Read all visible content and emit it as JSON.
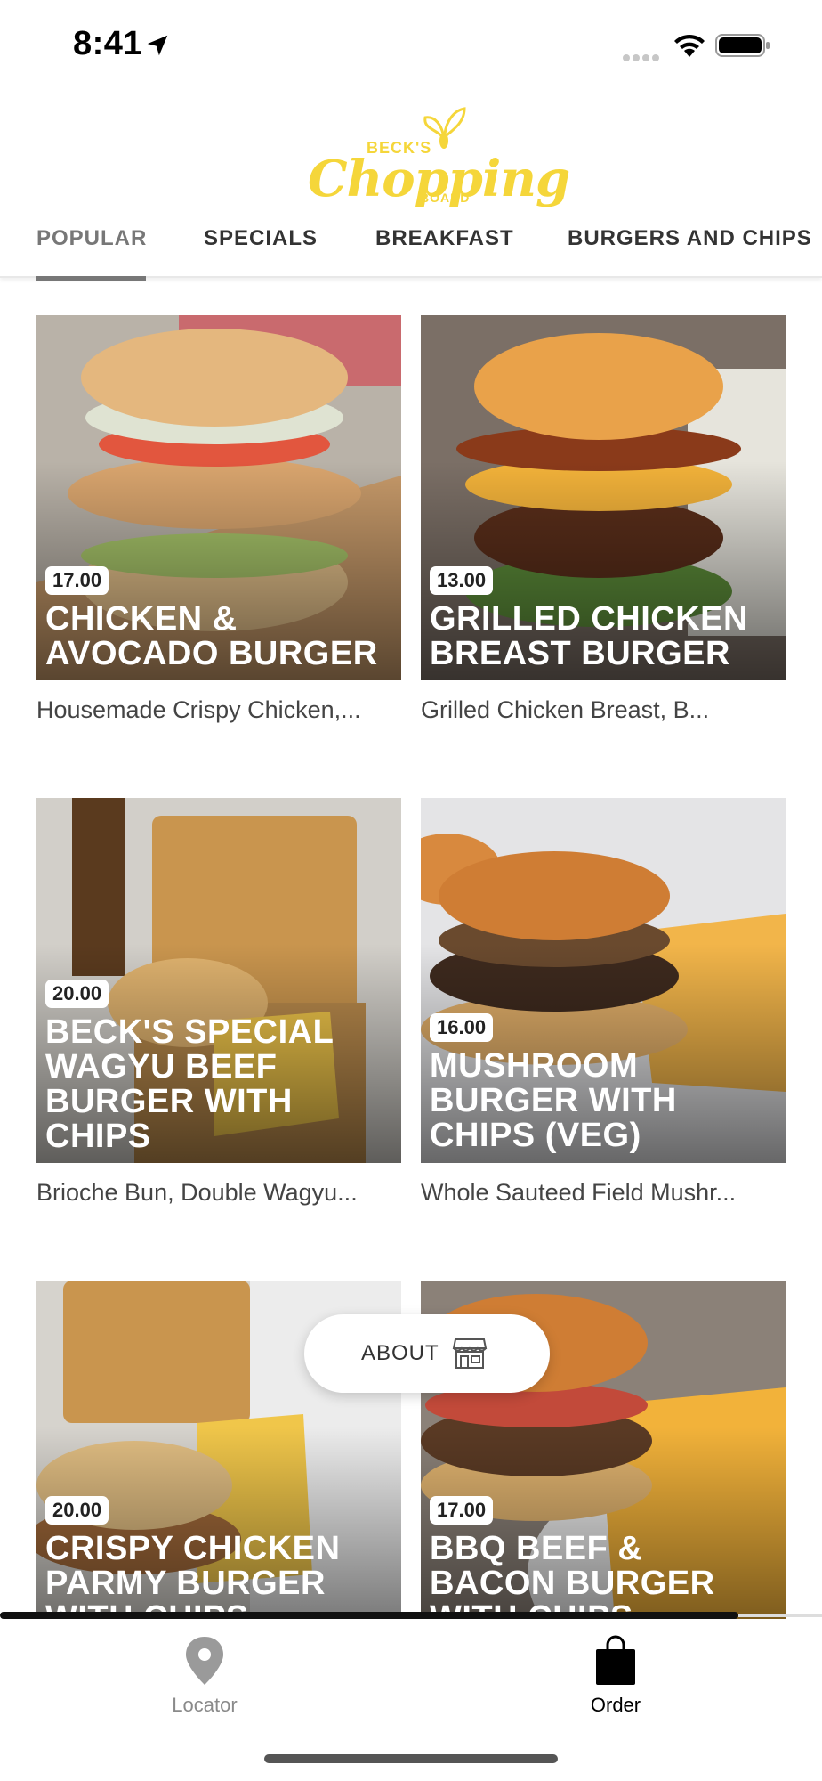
{
  "status_bar": {
    "time": "8:41"
  },
  "logo": {
    "small": "BECK'S",
    "main": "Chopping",
    "sub": "BOARD"
  },
  "tabs": [
    {
      "label": "POPULAR",
      "active": true
    },
    {
      "label": "SPECIALS"
    },
    {
      "label": "BREAKFAST"
    },
    {
      "label": "BURGERS AND CHIPS"
    }
  ],
  "menu_items": [
    {
      "price": "17.00",
      "title": "CHICKEN & AVOCADO BURGER",
      "description": "Housemade Crispy Chicken,..."
    },
    {
      "price": "13.00",
      "title": "GRILLED CHICKEN BREAST BURGER",
      "description": "Grilled Chicken Breast, B..."
    },
    {
      "price": "20.00",
      "title": "BECK'S SPECIAL WAGYU BEEF BURGER WITH CHIPS",
      "description": "Brioche Bun, Double Wagyu..."
    },
    {
      "price": "16.00",
      "title": "MUSHROOM BURGER WITH CHIPS (VEG)",
      "description": "Whole Sauteed Field Mushr..."
    },
    {
      "price": "20.00",
      "title": "CRISPY CHICKEN PARMY BURGER WITH CHIPS",
      "description": ""
    },
    {
      "price": "17.00",
      "title": "BBQ BEEF & BACON BURGER WITH CHIPS",
      "description": ""
    }
  ],
  "about_button": {
    "label": "ABOUT",
    "icon": "store-icon"
  },
  "bottom_nav": [
    {
      "label": "Locator",
      "icon": "location-pin-icon",
      "active": false
    },
    {
      "label": "Order",
      "icon": "shopping-bag-icon",
      "active": true
    }
  ],
  "colors": {
    "brand_yellow": "#f5d63a",
    "tab_active": "#777777",
    "text_dark": "#222222"
  }
}
